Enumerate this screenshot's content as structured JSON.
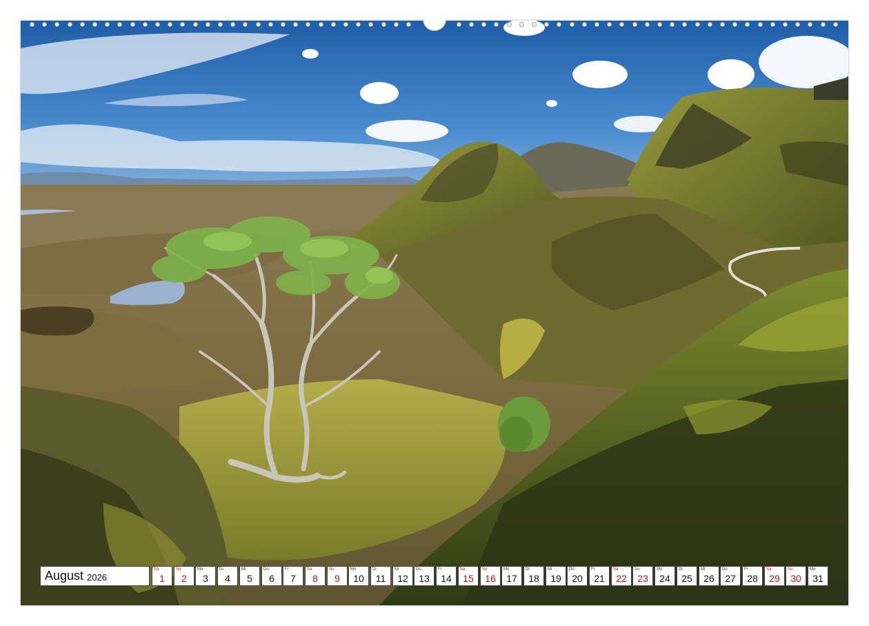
{
  "calendar": {
    "month": "August",
    "year": "2026",
    "days": [
      {
        "num": "1",
        "wd": "Sa",
        "weekend": true
      },
      {
        "num": "2",
        "wd": "So",
        "weekend": true
      },
      {
        "num": "3",
        "wd": "Mo",
        "weekend": false
      },
      {
        "num": "4",
        "wd": "Di",
        "weekend": false
      },
      {
        "num": "5",
        "wd": "Mi",
        "weekend": false
      },
      {
        "num": "6",
        "wd": "Do",
        "weekend": false
      },
      {
        "num": "7",
        "wd": "Fr",
        "weekend": false
      },
      {
        "num": "8",
        "wd": "Sa",
        "weekend": true
      },
      {
        "num": "9",
        "wd": "So",
        "weekend": true
      },
      {
        "num": "10",
        "wd": "Mo",
        "weekend": false
      },
      {
        "num": "11",
        "wd": "Di",
        "weekend": false
      },
      {
        "num": "12",
        "wd": "Mi",
        "weekend": false
      },
      {
        "num": "13",
        "wd": "Do",
        "weekend": false
      },
      {
        "num": "14",
        "wd": "Fr",
        "weekend": false
      },
      {
        "num": "15",
        "wd": "Sa",
        "weekend": true
      },
      {
        "num": "16",
        "wd": "So",
        "weekend": true
      },
      {
        "num": "17",
        "wd": "Mo",
        "weekend": false
      },
      {
        "num": "18",
        "wd": "Di",
        "weekend": false
      },
      {
        "num": "19",
        "wd": "Mi",
        "weekend": false
      },
      {
        "num": "20",
        "wd": "Do",
        "weekend": false
      },
      {
        "num": "21",
        "wd": "Fr",
        "weekend": false
      },
      {
        "num": "22",
        "wd": "Sa",
        "weekend": true
      },
      {
        "num": "23",
        "wd": "So",
        "weekend": true
      },
      {
        "num": "24",
        "wd": "Mo",
        "weekend": false
      },
      {
        "num": "25",
        "wd": "Di",
        "weekend": false
      },
      {
        "num": "26",
        "wd": "Mi",
        "weekend": false
      },
      {
        "num": "27",
        "wd": "Do",
        "weekend": false
      },
      {
        "num": "28",
        "wd": "Fr",
        "weekend": false
      },
      {
        "num": "29",
        "wd": "Sa",
        "weekend": true
      },
      {
        "num": "30",
        "wd": "So",
        "weekend": true
      },
      {
        "num": "31",
        "wd": "Mo",
        "weekend": false
      }
    ]
  },
  "colors": {
    "weekend": "#b8141e",
    "sky": "#2f6fb8",
    "grass": "#8a8a2c"
  },
  "icons": {
    "hanger": "calendar-hanger-icon",
    "binding": "spiral-binding-holes"
  }
}
